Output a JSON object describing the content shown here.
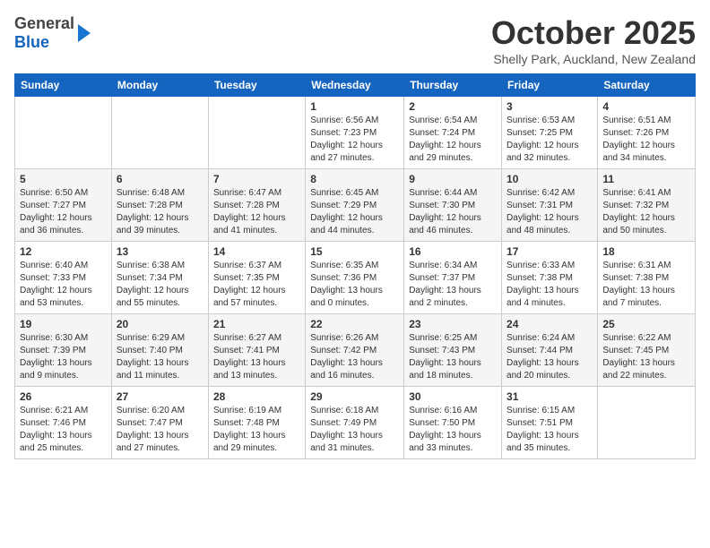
{
  "header": {
    "logo_general": "General",
    "logo_blue": "Blue",
    "month": "October 2025",
    "location": "Shelly Park, Auckland, New Zealand"
  },
  "days_of_week": [
    "Sunday",
    "Monday",
    "Tuesday",
    "Wednesday",
    "Thursday",
    "Friday",
    "Saturday"
  ],
  "weeks": [
    [
      {
        "day": "",
        "sunrise": "",
        "sunset": "",
        "daylight": ""
      },
      {
        "day": "",
        "sunrise": "",
        "sunset": "",
        "daylight": ""
      },
      {
        "day": "",
        "sunrise": "",
        "sunset": "",
        "daylight": ""
      },
      {
        "day": "1",
        "sunrise": "Sunrise: 6:56 AM",
        "sunset": "Sunset: 7:23 PM",
        "daylight": "Daylight: 12 hours and 27 minutes."
      },
      {
        "day": "2",
        "sunrise": "Sunrise: 6:54 AM",
        "sunset": "Sunset: 7:24 PM",
        "daylight": "Daylight: 12 hours and 29 minutes."
      },
      {
        "day": "3",
        "sunrise": "Sunrise: 6:53 AM",
        "sunset": "Sunset: 7:25 PM",
        "daylight": "Daylight: 12 hours and 32 minutes."
      },
      {
        "day": "4",
        "sunrise": "Sunrise: 6:51 AM",
        "sunset": "Sunset: 7:26 PM",
        "daylight": "Daylight: 12 hours and 34 minutes."
      }
    ],
    [
      {
        "day": "5",
        "sunrise": "Sunrise: 6:50 AM",
        "sunset": "Sunset: 7:27 PM",
        "daylight": "Daylight: 12 hours and 36 minutes."
      },
      {
        "day": "6",
        "sunrise": "Sunrise: 6:48 AM",
        "sunset": "Sunset: 7:28 PM",
        "daylight": "Daylight: 12 hours and 39 minutes."
      },
      {
        "day": "7",
        "sunrise": "Sunrise: 6:47 AM",
        "sunset": "Sunset: 7:28 PM",
        "daylight": "Daylight: 12 hours and 41 minutes."
      },
      {
        "day": "8",
        "sunrise": "Sunrise: 6:45 AM",
        "sunset": "Sunset: 7:29 PM",
        "daylight": "Daylight: 12 hours and 44 minutes."
      },
      {
        "day": "9",
        "sunrise": "Sunrise: 6:44 AM",
        "sunset": "Sunset: 7:30 PM",
        "daylight": "Daylight: 12 hours and 46 minutes."
      },
      {
        "day": "10",
        "sunrise": "Sunrise: 6:42 AM",
        "sunset": "Sunset: 7:31 PM",
        "daylight": "Daylight: 12 hours and 48 minutes."
      },
      {
        "day": "11",
        "sunrise": "Sunrise: 6:41 AM",
        "sunset": "Sunset: 7:32 PM",
        "daylight": "Daylight: 12 hours and 50 minutes."
      }
    ],
    [
      {
        "day": "12",
        "sunrise": "Sunrise: 6:40 AM",
        "sunset": "Sunset: 7:33 PM",
        "daylight": "Daylight: 12 hours and 53 minutes."
      },
      {
        "day": "13",
        "sunrise": "Sunrise: 6:38 AM",
        "sunset": "Sunset: 7:34 PM",
        "daylight": "Daylight: 12 hours and 55 minutes."
      },
      {
        "day": "14",
        "sunrise": "Sunrise: 6:37 AM",
        "sunset": "Sunset: 7:35 PM",
        "daylight": "Daylight: 12 hours and 57 minutes."
      },
      {
        "day": "15",
        "sunrise": "Sunrise: 6:35 AM",
        "sunset": "Sunset: 7:36 PM",
        "daylight": "Daylight: 13 hours and 0 minutes."
      },
      {
        "day": "16",
        "sunrise": "Sunrise: 6:34 AM",
        "sunset": "Sunset: 7:37 PM",
        "daylight": "Daylight: 13 hours and 2 minutes."
      },
      {
        "day": "17",
        "sunrise": "Sunrise: 6:33 AM",
        "sunset": "Sunset: 7:38 PM",
        "daylight": "Daylight: 13 hours and 4 minutes."
      },
      {
        "day": "18",
        "sunrise": "Sunrise: 6:31 AM",
        "sunset": "Sunset: 7:38 PM",
        "daylight": "Daylight: 13 hours and 7 minutes."
      }
    ],
    [
      {
        "day": "19",
        "sunrise": "Sunrise: 6:30 AM",
        "sunset": "Sunset: 7:39 PM",
        "daylight": "Daylight: 13 hours and 9 minutes."
      },
      {
        "day": "20",
        "sunrise": "Sunrise: 6:29 AM",
        "sunset": "Sunset: 7:40 PM",
        "daylight": "Daylight: 13 hours and 11 minutes."
      },
      {
        "day": "21",
        "sunrise": "Sunrise: 6:27 AM",
        "sunset": "Sunset: 7:41 PM",
        "daylight": "Daylight: 13 hours and 13 minutes."
      },
      {
        "day": "22",
        "sunrise": "Sunrise: 6:26 AM",
        "sunset": "Sunset: 7:42 PM",
        "daylight": "Daylight: 13 hours and 16 minutes."
      },
      {
        "day": "23",
        "sunrise": "Sunrise: 6:25 AM",
        "sunset": "Sunset: 7:43 PM",
        "daylight": "Daylight: 13 hours and 18 minutes."
      },
      {
        "day": "24",
        "sunrise": "Sunrise: 6:24 AM",
        "sunset": "Sunset: 7:44 PM",
        "daylight": "Daylight: 13 hours and 20 minutes."
      },
      {
        "day": "25",
        "sunrise": "Sunrise: 6:22 AM",
        "sunset": "Sunset: 7:45 PM",
        "daylight": "Daylight: 13 hours and 22 minutes."
      }
    ],
    [
      {
        "day": "26",
        "sunrise": "Sunrise: 6:21 AM",
        "sunset": "Sunset: 7:46 PM",
        "daylight": "Daylight: 13 hours and 25 minutes."
      },
      {
        "day": "27",
        "sunrise": "Sunrise: 6:20 AM",
        "sunset": "Sunset: 7:47 PM",
        "daylight": "Daylight: 13 hours and 27 minutes."
      },
      {
        "day": "28",
        "sunrise": "Sunrise: 6:19 AM",
        "sunset": "Sunset: 7:48 PM",
        "daylight": "Daylight: 13 hours and 29 minutes."
      },
      {
        "day": "29",
        "sunrise": "Sunrise: 6:18 AM",
        "sunset": "Sunset: 7:49 PM",
        "daylight": "Daylight: 13 hours and 31 minutes."
      },
      {
        "day": "30",
        "sunrise": "Sunrise: 6:16 AM",
        "sunset": "Sunset: 7:50 PM",
        "daylight": "Daylight: 13 hours and 33 minutes."
      },
      {
        "day": "31",
        "sunrise": "Sunrise: 6:15 AM",
        "sunset": "Sunset: 7:51 PM",
        "daylight": "Daylight: 13 hours and 35 minutes."
      },
      {
        "day": "",
        "sunrise": "",
        "sunset": "",
        "daylight": ""
      }
    ]
  ]
}
